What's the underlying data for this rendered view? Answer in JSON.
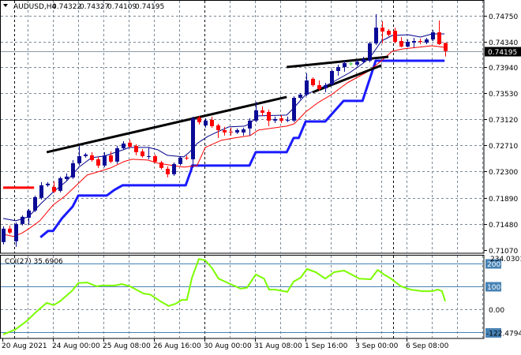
{
  "header": {
    "symbol": "AUDUSD,H4",
    "open": "0.74322",
    "high": "0.74327",
    "low": "0.74109",
    "close": "0.74195",
    "collapse_icon": "triangle-down-icon"
  },
  "indicator_header": {
    "label": "CCI(27) 35.6906"
  },
  "colors": {
    "bull": "#0a0a96",
    "bear": "#ff0000",
    "doji": "#32cd32",
    "ma_fast": "#00008b",
    "ma_slow": "#ff0000",
    "step_line": "#1a1aff",
    "step_line_start": "#ff0000",
    "trendline": "#000000",
    "cci_line": "#7cfc00",
    "cci_level": "#4682b4",
    "grid": "#7a8896",
    "price_line": "#8a9aa6",
    "separator": "#000000"
  },
  "chart_data": [
    {
      "type": "candlestick",
      "title": "AUDUSD,H4",
      "ylim": [
        0.7107,
        0.7475
      ],
      "y_ticks": [
        "0.74750",
        "0.74340",
        "0.73940",
        "0.73530",
        "0.73120",
        "0.72710",
        "0.72300",
        "0.71890",
        "0.71480",
        "0.71070"
      ],
      "current_price_label": "0.74195",
      "current_price": 0.74195,
      "x_tick_labels": [
        {
          "index": 0,
          "label": "20 Aug 2021"
        },
        {
          "index": 8,
          "label": "24 Aug 00:00"
        },
        {
          "index": 16,
          "label": "25 Aug 08:00"
        },
        {
          "index": 24,
          "label": "26 Aug 16:00"
        },
        {
          "index": 32,
          "label": "30 Aug 00:00"
        },
        {
          "index": 40,
          "label": "31 Aug 08:00"
        },
        {
          "index": 48,
          "label": "1 Sep 16:00"
        },
        {
          "index": 56,
          "label": "3 Sep 00:00"
        },
        {
          "index": 64,
          "label": "6 Sep 08:00"
        }
      ],
      "doji_indices": [
        55
      ],
      "candles_ohlc": [
        [
          0.71191,
          0.71439,
          0.71154,
          0.71402
        ],
        [
          0.71402,
          0.71452,
          0.71315,
          0.7134
        ],
        [
          0.71204,
          0.71501,
          0.71117,
          0.71476
        ],
        [
          0.71476,
          0.71613,
          0.71452,
          0.71588
        ],
        [
          0.71574,
          0.71712,
          0.71464,
          0.71687
        ],
        [
          0.71687,
          0.71923,
          0.71662,
          0.71898
        ],
        [
          0.71886,
          0.72134,
          0.71861,
          0.72084
        ],
        [
          0.72084,
          0.72134,
          0.72059,
          0.72109
        ],
        [
          0.72059,
          0.72146,
          0.7196,
          0.71985
        ],
        [
          0.71997,
          0.72221,
          0.71972,
          0.72196
        ],
        [
          0.72183,
          0.7227,
          0.72158,
          0.72221
        ],
        [
          0.72208,
          0.72481,
          0.72183,
          0.72431
        ],
        [
          0.72431,
          0.72704,
          0.72394,
          0.72543
        ],
        [
          0.72543,
          0.72592,
          0.72518,
          0.72568
        ],
        [
          0.72555,
          0.72605,
          0.72456,
          0.72481
        ],
        [
          0.72493,
          0.7253,
          0.72357,
          0.72394
        ],
        [
          0.72394,
          0.72605,
          0.72369,
          0.72555
        ],
        [
          0.72555,
          0.72617,
          0.72431,
          0.72456
        ],
        [
          0.72456,
          0.72704,
          0.72419,
          0.72667
        ],
        [
          0.72667,
          0.72778,
          0.72642,
          0.72741
        ],
        [
          0.72754,
          0.72803,
          0.72667,
          0.72692
        ],
        [
          0.72704,
          0.72729,
          0.72555,
          0.72605
        ],
        [
          0.72617,
          0.72654,
          0.72518,
          0.72543
        ],
        [
          0.7253,
          0.72679,
          0.72493,
          0.72543
        ],
        [
          0.72543,
          0.72568,
          0.72431,
          0.72456
        ],
        [
          0.72444,
          0.72468,
          0.72332,
          0.72357
        ],
        [
          0.72344,
          0.72382,
          0.72208,
          0.72258
        ],
        [
          0.72258,
          0.72444,
          0.72233,
          0.72419
        ],
        [
          0.72419,
          0.72543,
          0.72394,
          0.72518
        ],
        [
          0.72518,
          0.72555,
          0.72481,
          0.72506
        ],
        [
          0.72493,
          0.73163,
          0.72357,
          0.73138
        ],
        [
          0.7315,
          0.73175,
          0.73039,
          0.73076
        ],
        [
          0.73026,
          0.73138,
          0.72989,
          0.73101
        ],
        [
          0.73113,
          0.73163,
          0.72989,
          0.73014
        ],
        [
          0.73026,
          0.73051,
          0.72828,
          0.72952
        ],
        [
          0.72952,
          0.73002,
          0.72865,
          0.72915
        ],
        [
          0.72927,
          0.72989,
          0.72865,
          0.72915
        ],
        [
          0.72915,
          0.72977,
          0.7289,
          0.72952
        ],
        [
          0.72915,
          0.72989,
          0.72865,
          0.72964
        ],
        [
          0.72977,
          0.73138,
          0.72865,
          0.73101
        ],
        [
          0.73101,
          0.73398,
          0.73076,
          0.73262
        ],
        [
          0.73262,
          0.73324,
          0.73175,
          0.73225
        ],
        [
          0.73237,
          0.73274,
          0.73014,
          0.73101
        ],
        [
          0.73101,
          0.73163,
          0.73064,
          0.73126
        ],
        [
          0.73138,
          0.73188,
          0.73064,
          0.73101
        ],
        [
          0.73101,
          0.73163,
          0.73076,
          0.73113
        ],
        [
          0.73101,
          0.73485,
          0.73076,
          0.7346
        ],
        [
          0.7346,
          0.73534,
          0.73436,
          0.7351
        ],
        [
          0.7351,
          0.73845,
          0.73485,
          0.73733
        ],
        [
          0.73758,
          0.73783,
          0.73634,
          0.73659
        ],
        [
          0.73659,
          0.73733,
          0.73572,
          0.73597
        ],
        [
          0.73609,
          0.73696,
          0.73547,
          0.73659
        ],
        [
          0.73671,
          0.73907,
          0.73646,
          0.73882
        ],
        [
          0.73882,
          0.73981,
          0.73808,
          0.73944
        ],
        [
          0.73944,
          0.74046,
          0.7387,
          0.74006
        ],
        [
          0.73994,
          0.74018,
          0.73969,
          0.73994
        ],
        [
          0.73981,
          0.74056,
          0.73956,
          0.74026
        ],
        [
          0.74026,
          0.74105,
          0.74006,
          0.74068
        ],
        [
          0.74043,
          0.74341,
          0.74018,
          0.74316
        ],
        [
          0.74316,
          0.74775,
          0.74291,
          0.74564
        ],
        [
          0.74564,
          0.74663,
          0.74316,
          0.74502
        ],
        [
          0.74514,
          0.74539,
          0.74428,
          0.74452
        ],
        [
          0.74514,
          0.74564,
          0.74316,
          0.74341
        ],
        [
          0.74353,
          0.74415,
          0.74254,
          0.74266
        ],
        [
          0.74266,
          0.74378,
          0.74254,
          0.74341
        ],
        [
          0.74328,
          0.74403,
          0.74254,
          0.74353
        ],
        [
          0.74353,
          0.7439,
          0.74304,
          0.74341
        ],
        [
          0.74328,
          0.74403,
          0.74304,
          0.74378
        ],
        [
          0.74378,
          0.74527,
          0.74353,
          0.7449
        ],
        [
          0.7449,
          0.74676,
          0.74291,
          0.74304
        ],
        [
          0.74322,
          0.74327,
          0.74109,
          0.74195
        ]
      ],
      "ma_fast": [
        [
          0,
          0.71563
        ],
        [
          2,
          0.71526
        ],
        [
          4,
          0.71588
        ],
        [
          6,
          0.71799
        ],
        [
          8,
          0.71985
        ],
        [
          10,
          0.72146
        ],
        [
          12,
          0.72369
        ],
        [
          14,
          0.72518
        ],
        [
          16,
          0.72543
        ],
        [
          19,
          0.72642
        ],
        [
          20,
          0.72679
        ],
        [
          23,
          0.72679
        ],
        [
          24.5,
          0.72642
        ],
        [
          26,
          0.72555
        ],
        [
          28.6,
          0.7253
        ],
        [
          29.5,
          0.72605
        ],
        [
          30.7,
          0.72741
        ],
        [
          32.4,
          0.72853
        ],
        [
          34,
          0.72927
        ],
        [
          35.7,
          0.73002
        ],
        [
          38.2,
          0.73014
        ],
        [
          39,
          0.73051
        ],
        [
          40.4,
          0.73175
        ],
        [
          44.9,
          0.73188
        ],
        [
          46,
          0.73299
        ],
        [
          47.9,
          0.7351
        ],
        [
          49.9,
          0.73597
        ],
        [
          52,
          0.73696
        ],
        [
          54.9,
          0.73857
        ],
        [
          57.9,
          0.74068
        ],
        [
          59.9,
          0.74353
        ],
        [
          61.6,
          0.7444
        ],
        [
          64.1,
          0.74452
        ],
        [
          66.1,
          0.74415
        ],
        [
          67.9,
          0.74465
        ],
        [
          69.9,
          0.74465
        ]
      ],
      "ma_slow": [
        [
          0,
          0.71315
        ],
        [
          1.6,
          0.71278
        ],
        [
          2.9,
          0.71328
        ],
        [
          4.1,
          0.71402
        ],
        [
          5.8,
          0.71526
        ],
        [
          7.9,
          0.71774
        ],
        [
          9.9,
          0.71923
        ],
        [
          12,
          0.72121
        ],
        [
          13.3,
          0.72245
        ],
        [
          15.4,
          0.72307
        ],
        [
          17,
          0.72357
        ],
        [
          19.1,
          0.72456
        ],
        [
          20.4,
          0.72493
        ],
        [
          22.9,
          0.72481
        ],
        [
          24.5,
          0.72431
        ],
        [
          28.6,
          0.72369
        ],
        [
          30.7,
          0.72394
        ],
        [
          32,
          0.72679
        ],
        [
          34.5,
          0.72791
        ],
        [
          36.6,
          0.72828
        ],
        [
          39.1,
          0.72865
        ],
        [
          40.4,
          0.72952
        ],
        [
          44.9,
          0.73014
        ],
        [
          46.1,
          0.73051
        ],
        [
          47.9,
          0.73237
        ],
        [
          49.9,
          0.73386
        ],
        [
          52,
          0.7351
        ],
        [
          54.5,
          0.73696
        ],
        [
          57.9,
          0.73882
        ],
        [
          59.9,
          0.74043
        ],
        [
          61.6,
          0.74192
        ],
        [
          63.3,
          0.74229
        ],
        [
          67.9,
          0.74279
        ],
        [
          69.9,
          0.74254
        ]
      ],
      "step_line": [
        [
          5.9,
          0.71266
        ],
        [
          7.1,
          0.71365
        ],
        [
          7.9,
          0.71365
        ],
        [
          9.3,
          0.71563
        ],
        [
          11,
          0.71749
        ],
        [
          11.9,
          0.71923
        ],
        [
          16.4,
          0.71923
        ],
        [
          17.6,
          0.7201
        ],
        [
          18.9,
          0.72084
        ],
        [
          28.9,
          0.72084
        ],
        [
          29.8,
          0.72332
        ],
        [
          29.9,
          0.72394
        ],
        [
          39,
          0.72394
        ],
        [
          40,
          0.72605
        ],
        [
          44.9,
          0.72605
        ],
        [
          46,
          0.72828
        ],
        [
          46.8,
          0.72828
        ],
        [
          47.9,
          0.73088
        ],
        [
          51,
          0.73088
        ],
        [
          53.9,
          0.73411
        ],
        [
          56.9,
          0.73411
        ],
        [
          59,
          0.74043
        ],
        [
          69.9,
          0.74043
        ]
      ],
      "step_line_start_segment": [
        [
          0,
          0.72047
        ],
        [
          4.9,
          0.72047
        ]
      ],
      "trendlines": [
        [
          [
            6.9,
            0.72605
          ],
          [
            44.9,
            0.73473
          ]
        ],
        [
          [
            44.9,
            0.73944
          ],
          [
            61,
            0.74105
          ]
        ],
        [
          [
            49,
            0.73547
          ],
          [
            59.9,
            0.73969
          ]
        ]
      ]
    },
    {
      "type": "line",
      "title": "CCI(27)",
      "current_value": 35.6906,
      "ylim": [
        -122.4794,
        234.0301
      ],
      "max_label": "234.0301",
      "min_label": "-122.4794",
      "levels": [
        {
          "value": 200,
          "label": "200"
        },
        {
          "value": 100,
          "label": "100"
        },
        {
          "value": -100,
          "label": ""
        }
      ],
      "zero_label": "0.00",
      "series": [
        [
          0,
          -109
        ],
        [
          1.9,
          -88
        ],
        [
          3.7,
          -51
        ],
        [
          5.3,
          -9
        ],
        [
          6.9,
          29
        ],
        [
          8,
          19
        ],
        [
          9,
          36
        ],
        [
          10.9,
          81
        ],
        [
          11.9,
          116
        ],
        [
          13.3,
          118
        ],
        [
          14.8,
          101
        ],
        [
          15.6,
          105
        ],
        [
          17.7,
          105
        ],
        [
          18.8,
          111
        ],
        [
          20.1,
          101
        ],
        [
          22.2,
          70
        ],
        [
          23.3,
          65
        ],
        [
          24.9,
          36
        ],
        [
          26.2,
          15
        ],
        [
          27.3,
          25
        ],
        [
          28.3,
          42
        ],
        [
          29.1,
          42
        ],
        [
          29.9,
          139
        ],
        [
          31,
          221
        ],
        [
          32,
          215
        ],
        [
          33.1,
          180
        ],
        [
          34.1,
          135
        ],
        [
          36,
          111
        ],
        [
          37.6,
          91
        ],
        [
          38.6,
          95
        ],
        [
          40,
          153
        ],
        [
          41.3,
          135
        ],
        [
          42.1,
          87
        ],
        [
          43.1,
          87
        ],
        [
          45,
          77
        ],
        [
          46,
          122
        ],
        [
          47.1,
          139
        ],
        [
          48.1,
          177
        ],
        [
          49.5,
          163
        ],
        [
          51,
          135
        ],
        [
          52.4,
          163
        ],
        [
          54,
          170
        ],
        [
          56.4,
          135
        ],
        [
          58.2,
          132
        ],
        [
          59.3,
          173
        ],
        [
          60.3,
          153
        ],
        [
          61.4,
          135
        ],
        [
          63,
          101
        ],
        [
          64.5,
          87
        ],
        [
          66.4,
          80
        ],
        [
          68,
          80
        ],
        [
          68.8,
          87
        ],
        [
          69.5,
          80
        ],
        [
          70,
          35.69
        ]
      ]
    }
  ]
}
